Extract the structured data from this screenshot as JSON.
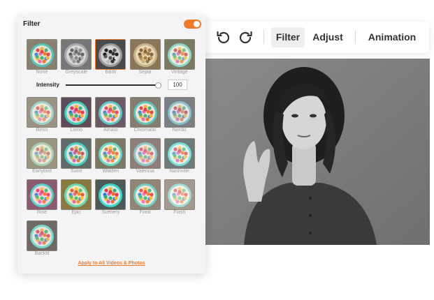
{
  "toolbar": {
    "undo_icon": "undo-icon",
    "redo_icon": "redo-icon",
    "tabs": [
      {
        "label": "Filter",
        "active": true
      },
      {
        "label": "Adjust",
        "active": false
      },
      {
        "label": "Animation",
        "active": false
      }
    ]
  },
  "panel": {
    "title": "Filter",
    "toggle_on": true,
    "accent_color": "#f07a2a",
    "basic_filters": [
      {
        "label": "None",
        "tone": "color"
      },
      {
        "label": "Greyscale",
        "tone": "grey"
      },
      {
        "label": "B&W",
        "tone": "bw",
        "selected": true
      },
      {
        "label": "Sepia",
        "tone": "sepia"
      },
      {
        "label": "Vintage",
        "tone": "vintage"
      }
    ],
    "intensity": {
      "label": "Intensity",
      "value": "100",
      "fraction": 0.96
    },
    "effect_filters": [
      {
        "label": "Retro",
        "tone": "retro"
      },
      {
        "label": "Lomo",
        "tone": "lomo"
      },
      {
        "label": "Amaro",
        "tone": "amaro"
      },
      {
        "label": "Chromatic",
        "tone": "chromatic"
      },
      {
        "label": "Nordic",
        "tone": "nordic"
      },
      {
        "label": "Earlybird",
        "tone": "earlybird"
      },
      {
        "label": "Sutro",
        "tone": "sutro"
      },
      {
        "label": "Walden",
        "tone": "walden"
      },
      {
        "label": "Valencia",
        "tone": "valencia"
      },
      {
        "label": "Nashville",
        "tone": "nashville"
      },
      {
        "label": "Rise",
        "tone": "rise"
      },
      {
        "label": "Epic",
        "tone": "epic"
      },
      {
        "label": "Scenery",
        "tone": "scenery"
      },
      {
        "label": "Food",
        "tone": "food"
      },
      {
        "label": "Flash",
        "tone": "flash"
      },
      {
        "label": "Backlit",
        "tone": "backlit"
      }
    ],
    "apply_link": "Apply to All Videos & Photos"
  }
}
